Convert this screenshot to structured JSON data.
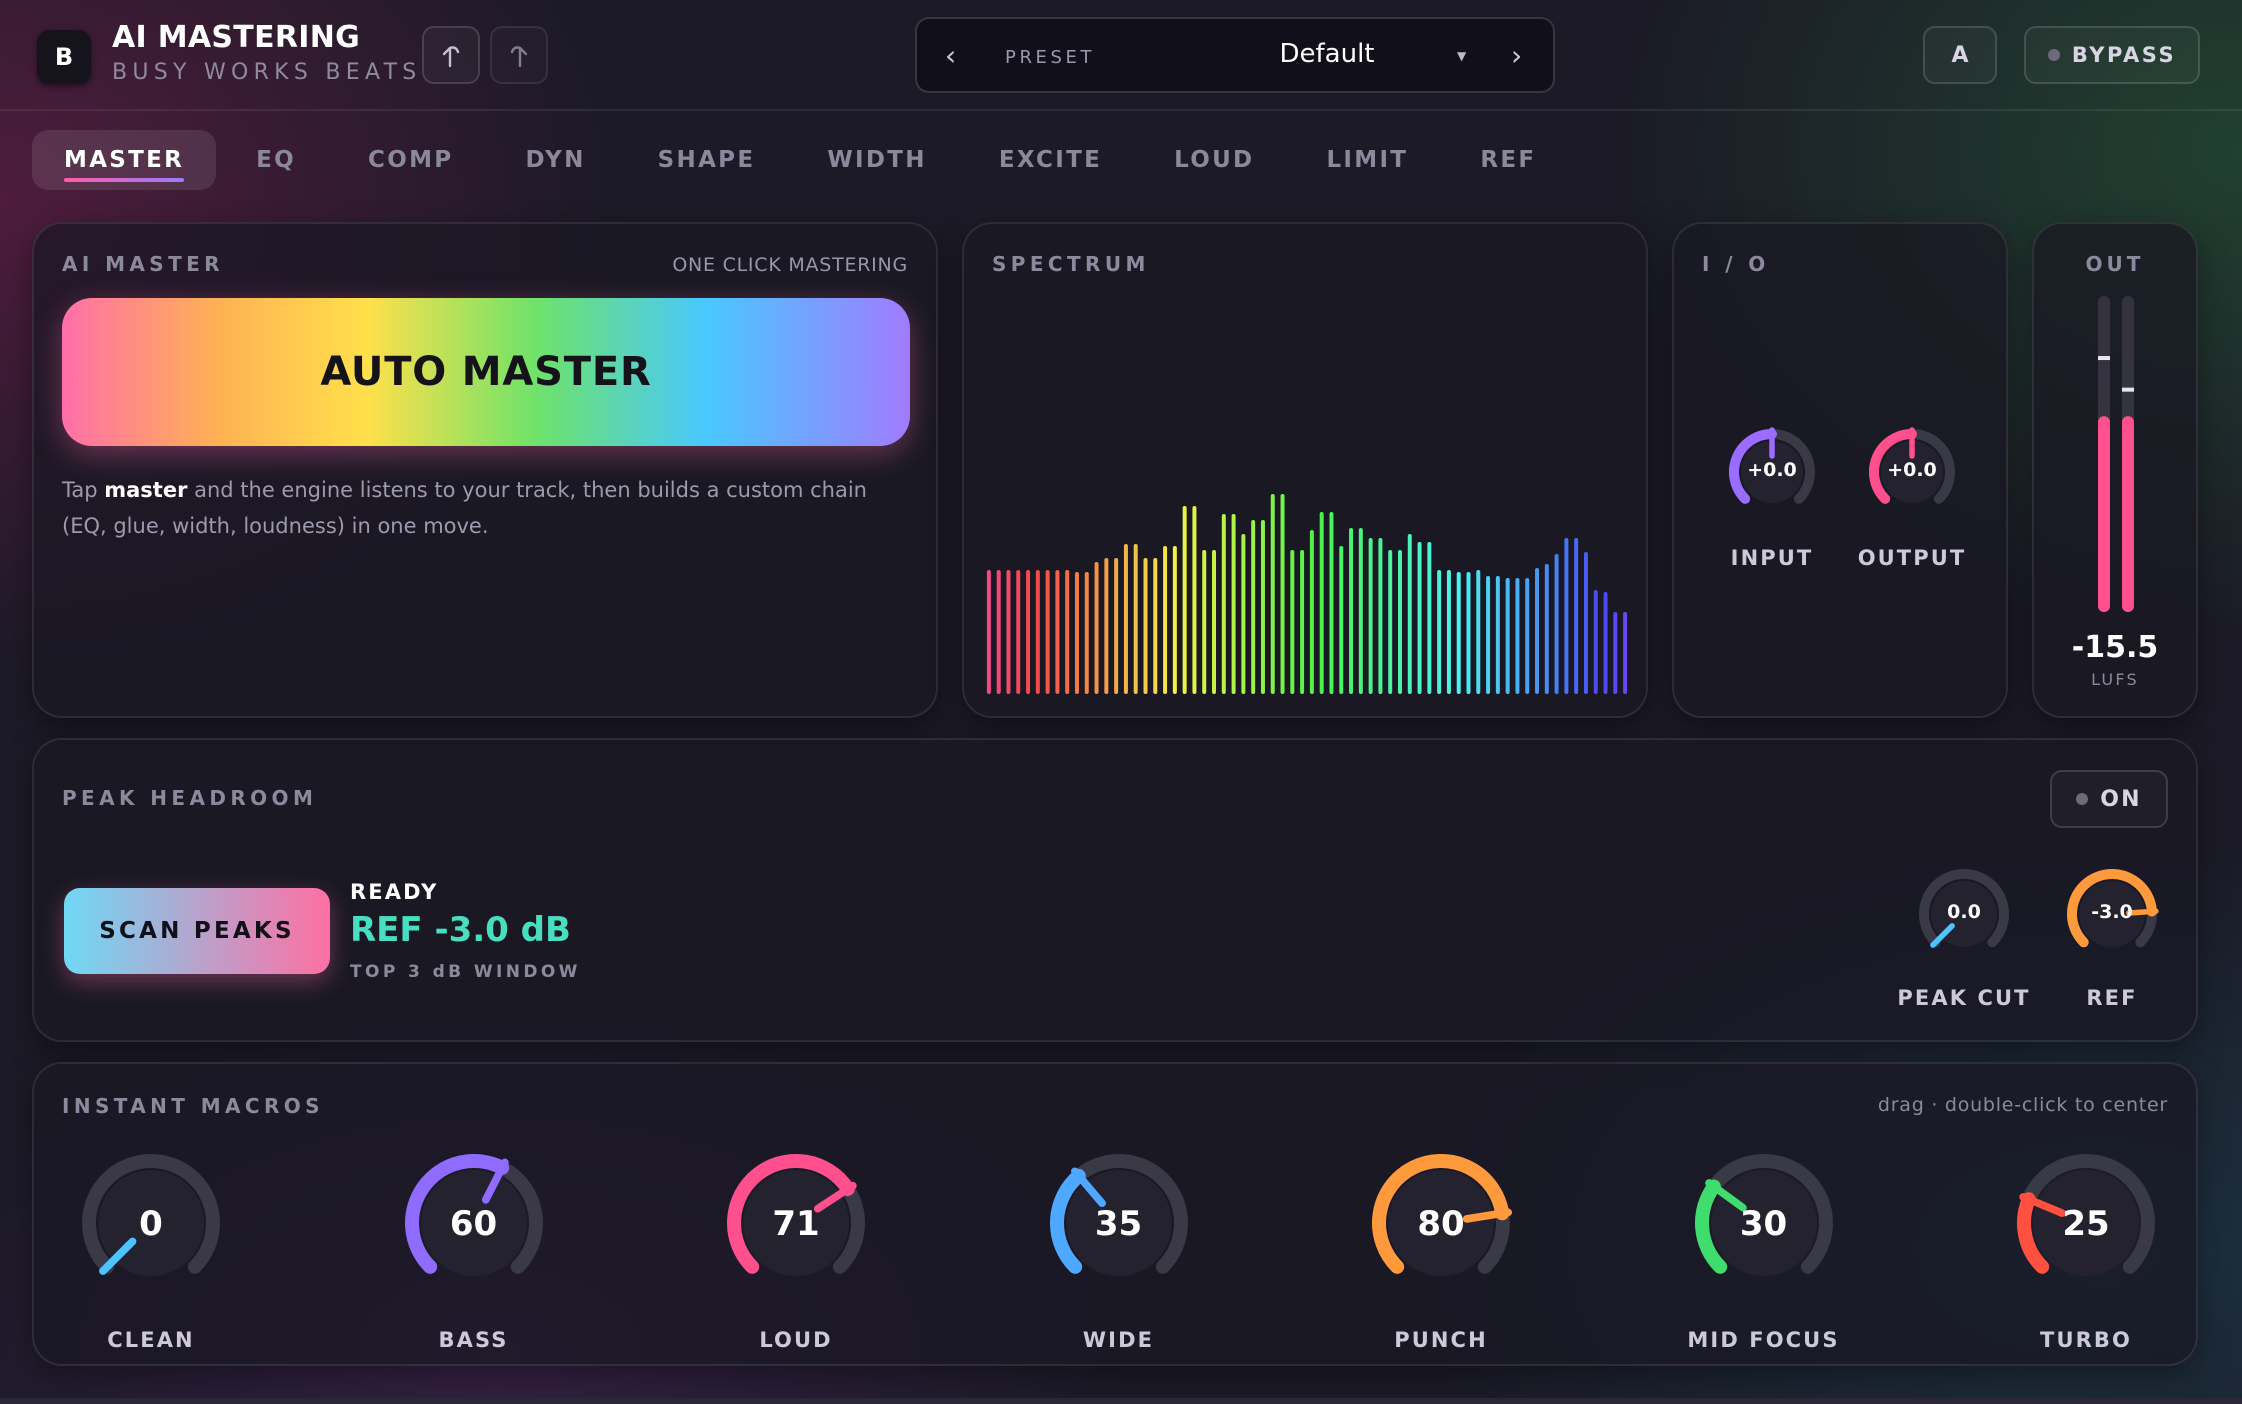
{
  "header": {
    "logo_letter": "B",
    "title": "AI MASTERING",
    "subtitle": "BUSY WORKS BEATS",
    "undo_icon": "undo-icon",
    "redo_icon": "redo-icon",
    "preset_prev": "‹",
    "preset_label": "PRESET",
    "preset_value": "Default",
    "preset_caret": "▼",
    "preset_next": "›",
    "ab_label": "A",
    "bypass_label": "BYPASS"
  },
  "tabs": [
    "MASTER",
    "EQ",
    "COMP",
    "DYN",
    "SHAPE",
    "WIDTH",
    "EXCITE",
    "LOUD",
    "LIMIT",
    "REF"
  ],
  "active_tab": "MASTER",
  "ai_master": {
    "title": "AI MASTER",
    "tagline": "ONE CLICK MASTERING",
    "button_label": "AUTO MASTER",
    "desc_pre": "Tap ",
    "desc_bold": "master",
    "desc_post": " and the engine listens to your track, then builds a custom chain (EQ, glue, width, loudness) in one move."
  },
  "spectrum": {
    "title": "SPECTRUM",
    "bar_levels": [
      0.6,
      0.6,
      0.6,
      0.6,
      0.6,
      0.6,
      0.6,
      0.6,
      0.6,
      0.59,
      0.59,
      0.64,
      0.66,
      0.66,
      0.73,
      0.73,
      0.66,
      0.66,
      0.72,
      0.72,
      0.92,
      0.92,
      0.7,
      0.7,
      0.88,
      0.88,
      0.78,
      0.85,
      0.85,
      0.98,
      0.98,
      0.7,
      0.7,
      0.8,
      0.89,
      0.89,
      0.72,
      0.81,
      0.81,
      0.76,
      0.76,
      0.7,
      0.7,
      0.78,
      0.74,
      0.74,
      0.6,
      0.6,
      0.59,
      0.59,
      0.6,
      0.57,
      0.57,
      0.56,
      0.56,
      0.56,
      0.61,
      0.63,
      0.68,
      0.76,
      0.76,
      0.69,
      0.5,
      0.49,
      0.39,
      0.39
    ]
  },
  "io": {
    "title": "I / O",
    "input_label": "INPUT",
    "input_value": "+0.0",
    "output_label": "OUTPUT",
    "output_value": "+0.0",
    "input_color": "#9a6cff",
    "output_color": "#ff4f8d"
  },
  "out_meter": {
    "title": "OUT",
    "value": "-15.5",
    "unit": "LUFS",
    "left_level": 0.62,
    "right_level": 0.62,
    "left_peak": 0.81,
    "right_peak": 0.71
  },
  "peak_headroom": {
    "title": "PEAK HEADROOM",
    "on_label": "ON",
    "scan_label": "SCAN PEAKS",
    "status": "READY",
    "ref_text": "REF -3.0 dB",
    "window_text": "TOP 3 dB WINDOW",
    "peak_cut_label": "PEAK CUT",
    "peak_cut_value": "0.0",
    "ref_label": "REF",
    "ref_value": "-3.0",
    "peak_cut_color": "#4fc3ff",
    "ref_color": "#ff9a3c"
  },
  "macros": {
    "title": "INSTANT MACROS",
    "hint": "drag · double-click to center",
    "items": [
      {
        "label": "CLEAN",
        "value": "0",
        "level": 0.0,
        "color": "#4fc3ff"
      },
      {
        "label": "BASS",
        "value": "60",
        "level": 0.6,
        "color": "#8f6cff"
      },
      {
        "label": "LOUD",
        "value": "71",
        "level": 0.71,
        "color": "#ff4f8d"
      },
      {
        "label": "WIDE",
        "value": "35",
        "level": 0.35,
        "color": "#4fa8ff"
      },
      {
        "label": "PUNCH",
        "value": "80",
        "level": 0.8,
        "color": "#ff9a3c"
      },
      {
        "label": "MID FOCUS",
        "value": "30",
        "level": 0.3,
        "color": "#3fdc6e"
      },
      {
        "label": "TURBO",
        "value": "25",
        "level": 0.25,
        "color": "#ff5040"
      }
    ]
  }
}
